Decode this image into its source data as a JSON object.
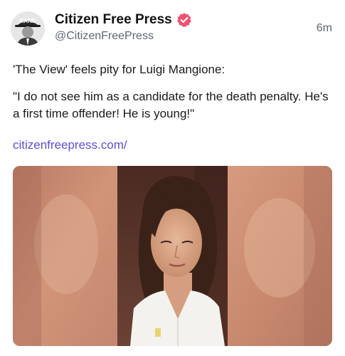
{
  "post": {
    "author": "Citizen Free Press",
    "handle": "@CitizenFreePress",
    "time": "6m",
    "avatar_text": "KANE",
    "text_line": "'The View' feels pity for Luigi Mangione:",
    "quote": "\"I do not see him as a candidate for the death penalty. He's a first time offender! He is young!\"",
    "link": "citizenfreepress.com/"
  },
  "icons": {
    "verified": "verified-badge-icon",
    "verified_color": "#f0506e"
  },
  "colors": {
    "link": "#5b4fd9",
    "muted": "#606770"
  }
}
